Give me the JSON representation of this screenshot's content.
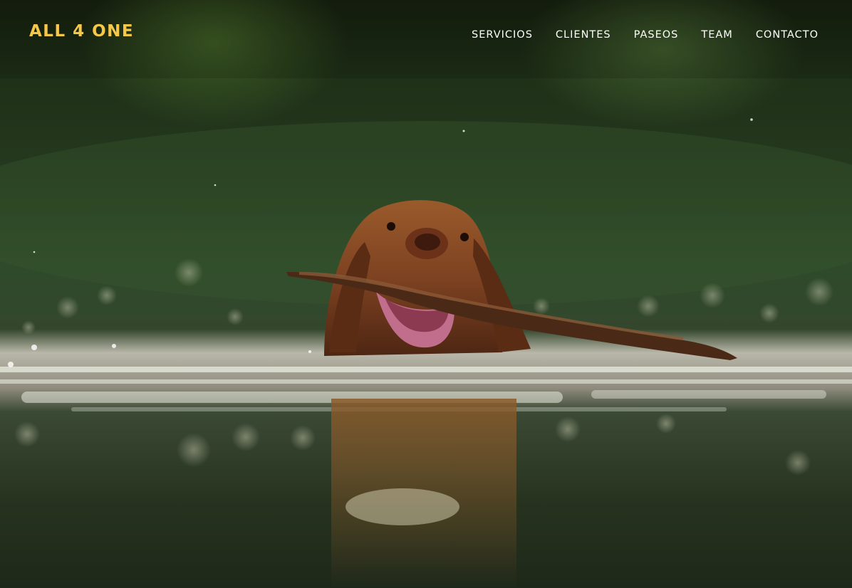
{
  "brand": {
    "logo_text": "ALL 4 ONE",
    "color": "#f5c84a"
  },
  "nav": {
    "items": [
      {
        "label": "SERVICIOS"
      },
      {
        "label": "CLIENTES"
      },
      {
        "label": "PASEOS"
      },
      {
        "label": "TEAM"
      },
      {
        "label": "CONTACTO"
      }
    ]
  },
  "hero": {
    "image_subject": "dog swimming in a lake carrying a stick"
  }
}
